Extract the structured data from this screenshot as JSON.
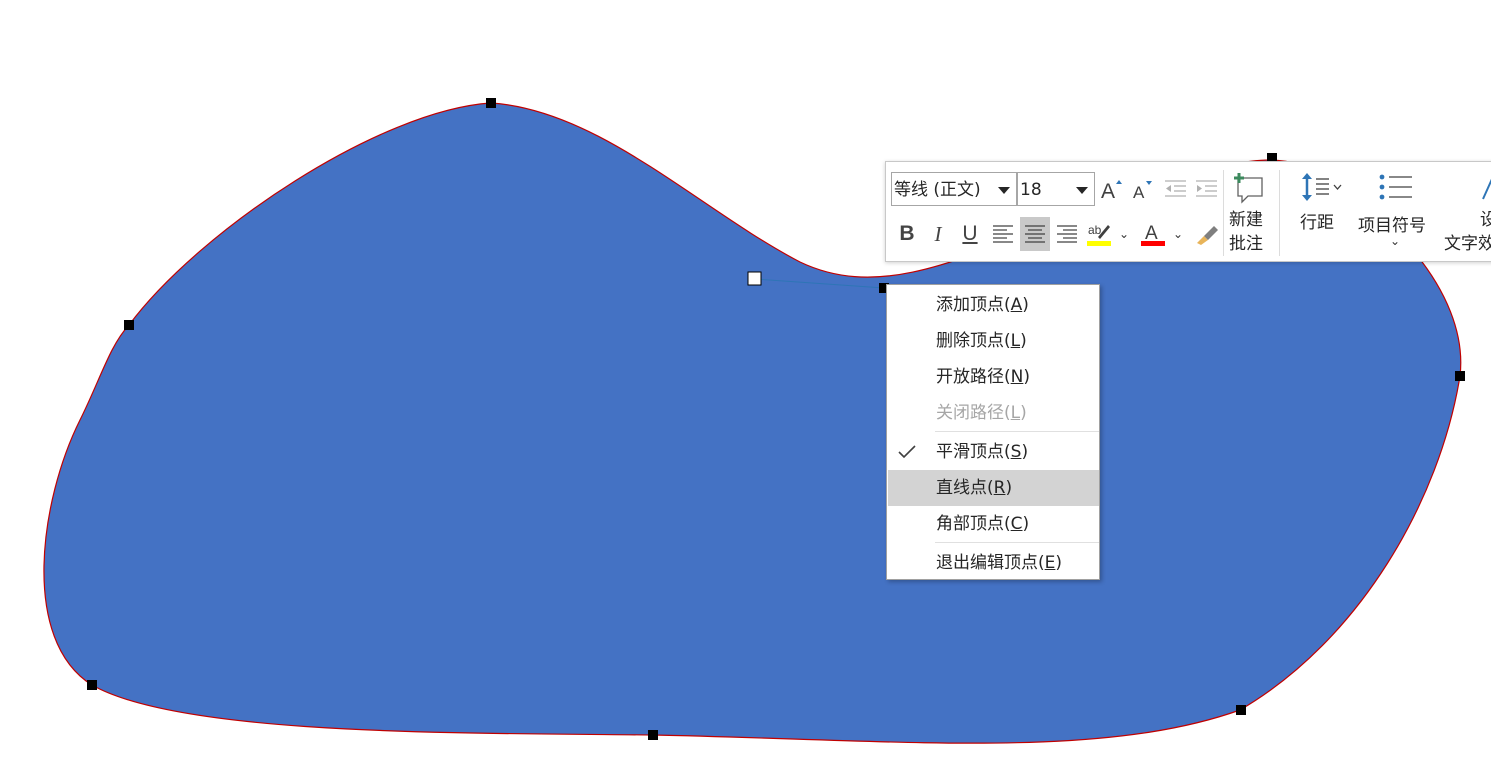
{
  "shape": {
    "fill": "#4472C4",
    "outline": "#C00000",
    "handle_color": "#000000",
    "control_line_color": "#2E75B6"
  },
  "toolbar": {
    "font_name": "等线 (正文)",
    "font_size": "18",
    "grow_font_icon": "grow-font-icon",
    "shrink_font_icon": "shrink-font-icon",
    "decrease_indent_icon": "decrease-indent-icon",
    "increase_indent_icon": "increase-indent-icon",
    "bold": "B",
    "italic": "I",
    "underline": "U",
    "highlight_color": "#FFFF00",
    "font_color": "#FF0000",
    "font_color_letter": "A",
    "new_comment_line1": "新建",
    "new_comment_line2": "批注",
    "line_spacing": "行距",
    "bullets": "项目符号",
    "text_effects_line1": "设",
    "text_effects_line2": "文字效"
  },
  "context_menu": {
    "items": [
      {
        "label": "添加顶点(",
        "key": "A",
        "suffix": ")",
        "enabled": true,
        "checked": false
      },
      {
        "label": "删除顶点(",
        "key": "L",
        "suffix": ")",
        "enabled": true,
        "checked": false
      },
      {
        "label": "开放路径(",
        "key": "N",
        "suffix": ")",
        "enabled": true,
        "checked": false
      },
      {
        "label": "关闭路径(",
        "key": "L",
        "suffix": ")",
        "enabled": false,
        "checked": false
      },
      {
        "label": "平滑顶点(",
        "key": "S",
        "suffix": ")",
        "enabled": true,
        "checked": true
      },
      {
        "label": "直线点(",
        "key": "R",
        "suffix": ")",
        "enabled": true,
        "checked": false,
        "highlighted": true
      },
      {
        "label": "角部顶点(",
        "key": "C",
        "suffix": ")",
        "enabled": true,
        "checked": false
      },
      {
        "label": "退出编辑顶点(",
        "key": "E",
        "suffix": ")",
        "enabled": true,
        "checked": false
      }
    ]
  }
}
